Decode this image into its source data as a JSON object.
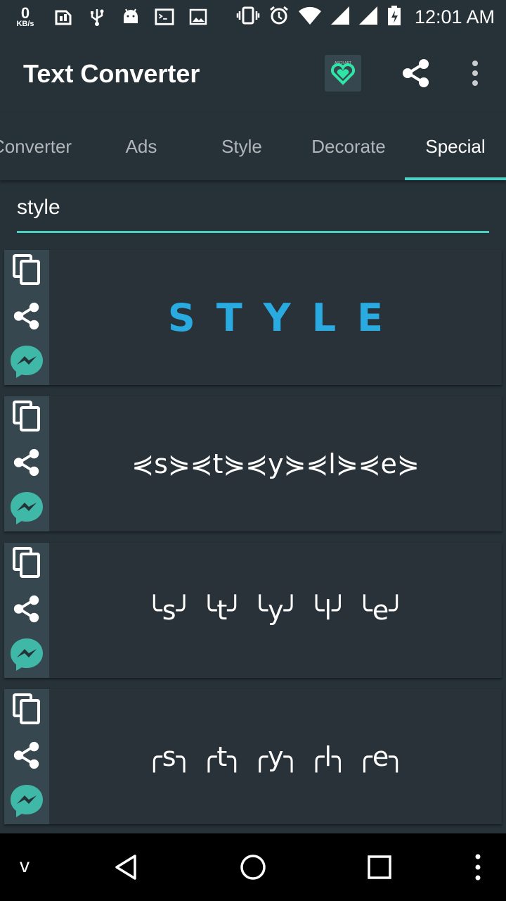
{
  "status_bar": {
    "net_speed_value": "0",
    "net_speed_unit": "KB/s",
    "time": "12:01 AM"
  },
  "toolbar": {
    "title": "Text Converter",
    "ascii_art_label": "ASCII ART"
  },
  "tabs": [
    {
      "label": "Converter",
      "active": false
    },
    {
      "label": "Ads",
      "active": false
    },
    {
      "label": "Style",
      "active": false
    },
    {
      "label": "Decorate",
      "active": false
    },
    {
      "label": "Special",
      "active": true
    }
  ],
  "input": {
    "value": "style"
  },
  "results": [
    {
      "text": "STYLE",
      "style": "styled"
    },
    {
      "text": "⋞s⋟⋞t⋟⋞y⋟⋞l⋟⋞e⋟",
      "style": "uni"
    },
    {
      "text": "╰s╯ ╰t╯ ╰y╯ ╰l╯ ╰e╯",
      "style": "uni"
    },
    {
      "text": "╭s╮ ╭t╮ ╭y╮ ╭l╮ ╭e╮",
      "style": "uni"
    }
  ],
  "colors": {
    "background": "#263238",
    "accent": "#4dd0c4",
    "styled_text": "#29abe2",
    "messenger": "#3fb8a8"
  },
  "nav": {
    "keyboard_hint": "v"
  }
}
